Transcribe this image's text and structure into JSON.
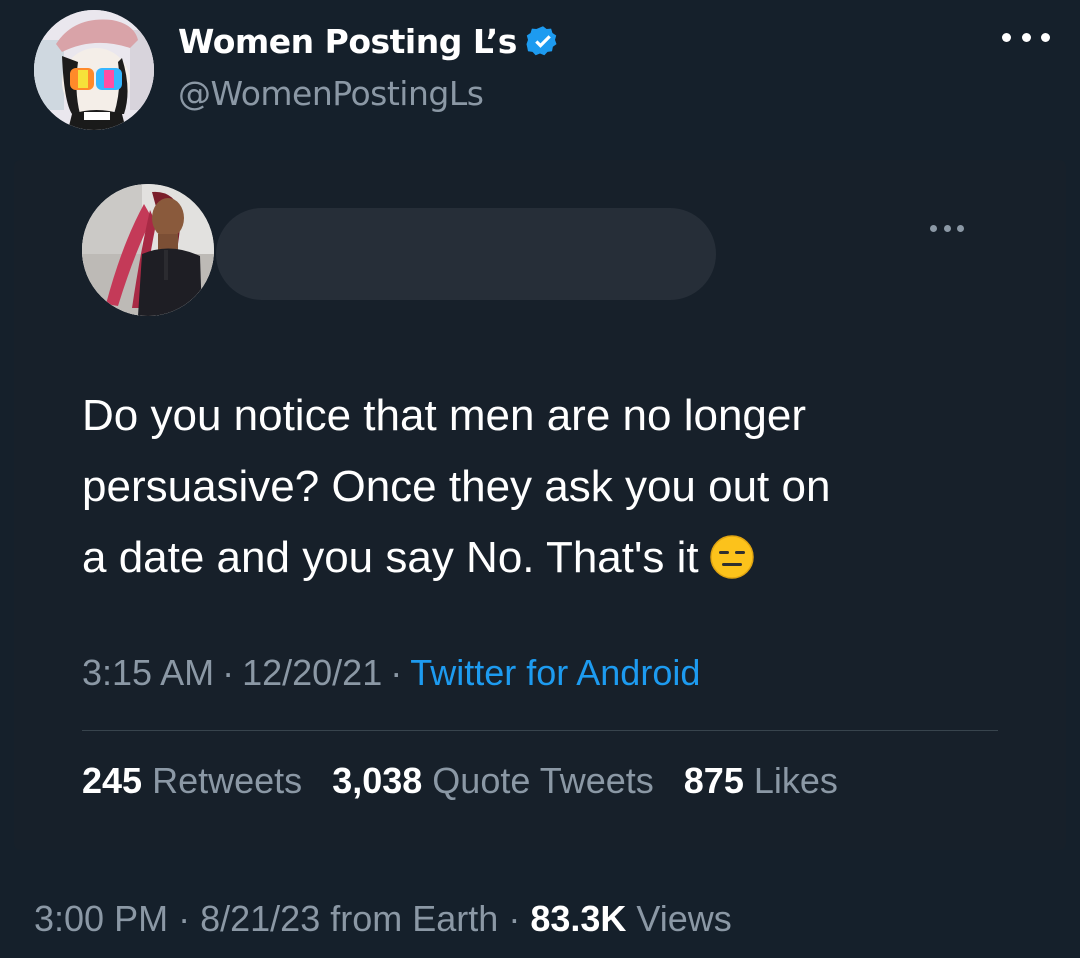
{
  "outer_tweet": {
    "author_name": "Women Posting L’s",
    "handle": "@WomenPostingLs",
    "verified_icon": "verified-badge-icon",
    "more_icon": "more-options-icon",
    "avatar": "avatar-image"
  },
  "quoted_tweet": {
    "avatar": "avatar-image",
    "name_redacted": true,
    "more_icon": "more-options-icon",
    "text_lines": [
      "Do you notice that men are no longer",
      "persuasive? Once they ask you out on",
      "a date and you say No. That's it"
    ],
    "emoji": "expressionless-face-emoji",
    "time": "3:15 AM",
    "date": "12/20/21",
    "separator": "·",
    "source": "Twitter for Android",
    "stats": {
      "retweets_count": "245",
      "retweets_label": "Retweets",
      "quotes_count": "3,038",
      "quotes_label": "Quote Tweets",
      "likes_count": "875",
      "likes_label": "Likes"
    }
  },
  "footer": {
    "time": "3:00 PM",
    "date": "8/21/23",
    "location": "from Earth",
    "separator": "·",
    "views_count": "83.3K",
    "views_label": "Views"
  },
  "colors": {
    "background": "#15202b",
    "text_primary": "#ffffff",
    "text_secondary": "#8b98a5",
    "accent": "#1d9bf0",
    "verified": "#1d9bf0"
  }
}
